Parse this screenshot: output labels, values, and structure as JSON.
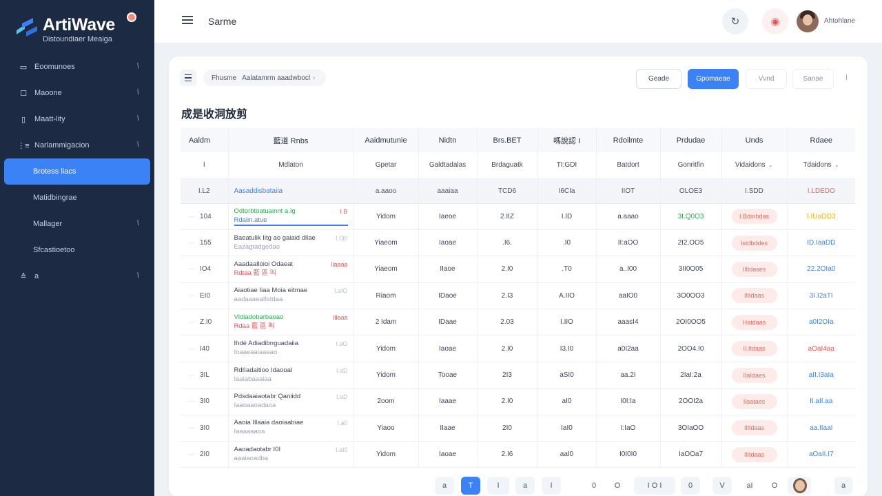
{
  "brand": {
    "name": "ArtiWave",
    "subtitle": "Distoundiaer Meaiga",
    "accent": "#3b82f6"
  },
  "sidebar": {
    "items": [
      {
        "label": "Eoomunoes"
      },
      {
        "label": "Maoone"
      },
      {
        "label": "Maatt-lity"
      },
      {
        "label": "Narlammigacion"
      },
      {
        "label": "Brotess liacs"
      },
      {
        "label": "Matidbingrae"
      },
      {
        "label": "Mallager"
      },
      {
        "label": "Sfcastioetoo"
      },
      {
        "label": "a"
      }
    ]
  },
  "topbar": {
    "title": "Sarme",
    "user_name": "Ahtohlane"
  },
  "toolbar": {
    "breadcrumb": [
      "Fhusme",
      "Aalatamrm aaadwbocl"
    ],
    "btn_outline": "Geade",
    "btn_primary": "Gpomaeae",
    "btn_ghost_1": "Vvnd",
    "btn_ghost_2": "Sanae",
    "more": "I"
  },
  "section": {
    "title": "成是收洞放剪"
  },
  "table": {
    "headers": [
      "Aaldm",
      "藍道 Rnbs",
      "Aaidmutunie",
      "Nidtn",
      "Brs.BET",
      "嗎說認 I",
      "Rdoilmte",
      "Prdudae",
      "Unds",
      "Rdaee"
    ],
    "subheaders": [
      "I",
      "Mdlaton",
      "Gpetar",
      "Galdtadalas",
      "Brdaguatk",
      "TI:GDI",
      "Batdort",
      "Gonritfin",
      "Vidaidons",
      "Tdaidons"
    ],
    "summary": [
      "I.L2",
      "Aasaddisbataiia",
      "a.aaoo",
      "aaaiaa",
      "TCD6",
      "I6CIa",
      "IIOT",
      "OLOE3",
      "I.SDD",
      "I.LDEDO"
    ],
    "rows": [
      {
        "id": "104",
        "prod_1": "Odtorbtoatuainnt a.Ig",
        "prod_2": "Rdaiin.atue",
        "note": "I.B",
        "c3": "Yidom",
        "c4": "Iaeoe",
        "c5": "2.IIZ",
        "c6": "I.ID",
        "c7": "a.aaao",
        "c8": "3I.Q0O3",
        "badge": "I.Bdmbdas",
        "rate": "I.IUaDO3"
      },
      {
        "id": "155",
        "prod_1": "Baeatulik Iitg ao gaiaid dllae",
        "prod_2": "Eazagtadgedao",
        "note": "I.I30",
        "c3": "Yiaeom",
        "c4": "Iaoae",
        "c5": ".I6.",
        "c6": ".I0",
        "c7": "II:aOO",
        "c8": "2I2,OO5",
        "badge": "Istdbddes",
        "rate": "ID.IaaDD"
      },
      {
        "id": "IO4",
        "prod_1": "Aaadaalloioi Odaeat",
        "prod_2": "Rdtaa 藍 區 叫",
        "note": "Ilaaaa",
        "c3": "Yiaeom",
        "c4": "IIaoe",
        "c5": "2.I0",
        "c6": ".T0",
        "c7": "a..I00",
        "c8": "3II0O05",
        "badge": "IIltdases",
        "rate": "22.2OIa0"
      },
      {
        "id": "EI0",
        "prod_1": "Aiaotiae Iiaa Moia eitmae",
        "prod_2": "aadaaaeaIIstdaa",
        "note": "I.aIO",
        "c3": "Riaom",
        "c4": "IDaoe",
        "c5": "2.I3",
        "c6": "A.IIO",
        "c7": "aaIO0",
        "c8": "3O0OO3",
        "badge": "IIltdaas",
        "rate": "3I.I2aTI"
      },
      {
        "id": "Z.I0",
        "prod_1": "Vldiadobarbaoao",
        "prod_2": "Rdaa 藍 區 叫",
        "note": "Illaaa",
        "c3": "2 Idam",
        "c4": "IDaae",
        "c5": "2.03",
        "c6": "I.IIO",
        "c7": "aaasI4",
        "c8": "2OI0OO5",
        "badge": "Hatdaas",
        "rate": "a0I2OIa"
      },
      {
        "id": "I40",
        "prod_1": "Ihdé Adiadibnguadaiia",
        "prod_2": "Ioaaeaaiaaaao",
        "note": "I.aO",
        "c3": "Yidom",
        "c4": "Iaoae",
        "c5": "2.I0",
        "c6": "I3.I0",
        "c7": "a0I2aa",
        "c8": "2OO4.I0",
        "badge": "II.Itdaas",
        "rate": "aOaI4aa"
      },
      {
        "id": "3IL",
        "prod_1": "RdIIadaitioo IdaooaI",
        "prod_2": "Iaaiabaaaiaa",
        "note": "I.aD",
        "c3": "Yidom",
        "c4": "Tooae",
        "c5": "2I3",
        "c6": "aSI0",
        "c7": "aa.2I",
        "c8": "2IaI:2a",
        "badge": "IIaIdaes",
        "rate": "aII.I3aIa"
      },
      {
        "id": "3I0",
        "prod_1": "Pdsdaaiaotabr Qaniidd",
        "prod_2": "Iaaoaaoadaoa",
        "note": "I.aD",
        "c3": "2oom",
        "c4": "Iaaae",
        "c5": "2.I0",
        "c6": "aI0",
        "c7": "I0I:Ia",
        "c8": "2OOI2a",
        "badge": "Ilaataes",
        "rate": "II.aII.aa"
      },
      {
        "id": "3I0",
        "prod_1": "Aaoia Illaaia daoiaabiae",
        "prod_2": "Iaaaaaaoa",
        "note": "I.a0",
        "c3": "Yiaoo",
        "c4": "IIaae",
        "c5": "2I0",
        "c6": "IaI0",
        "c7": "I:IaO",
        "c8": "3OIaOO",
        "badge": "IIltdaas",
        "rate": "aa.IIaaI"
      },
      {
        "id": "2I0",
        "prod_1": "Aaoadaotabr I0I",
        "prod_2": "aaaiaoadba",
        "note": "I.aI0",
        "c3": "Yidom",
        "c4": "Iaoae",
        "c5": "2.I6",
        "c6": "aaI0",
        "c7": "I0I0I0",
        "c8": "IaOOa7",
        "badge": "IIltdaas",
        "rate": "aOaII.I7"
      }
    ]
  },
  "pagination": [
    "a",
    "T",
    "I",
    "a",
    "I",
    "0",
    "O",
    "I O I",
    "0",
    "V",
    "aI",
    "O",
    "a"
  ],
  "colors": {
    "sidebar_bg": "#1c2a44",
    "primary": "#3b82f6",
    "badge_bg": "#fdebea",
    "badge_text": "#e86a5a",
    "positive": "#2fa84f",
    "negative": "#e25b5b",
    "highlight": "#f0b400"
  }
}
